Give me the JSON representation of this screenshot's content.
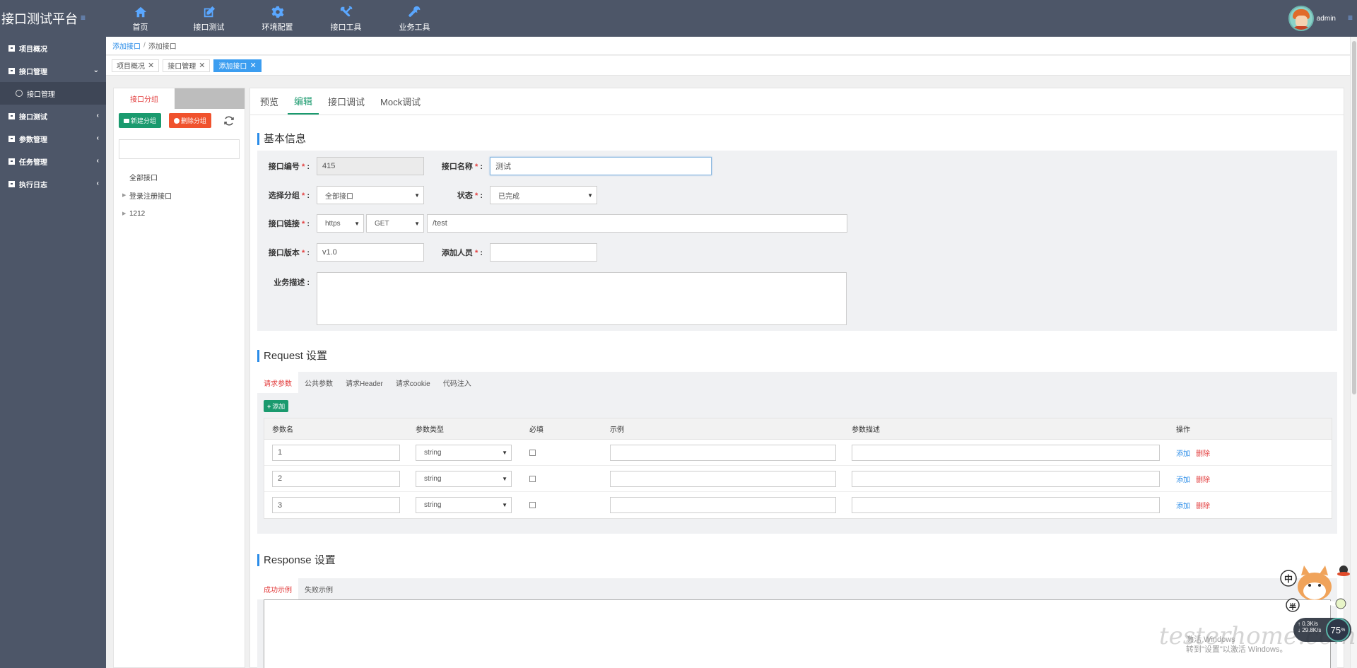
{
  "app": {
    "title": "接口测试平台",
    "menu_toggle": "≡"
  },
  "top_nav": [
    {
      "label": "首页",
      "icon": "home-icon"
    },
    {
      "label": "接口测试",
      "icon": "edit-icon"
    },
    {
      "label": "环境配置",
      "icon": "gear-icon"
    },
    {
      "label": "接口工具",
      "icon": "tools-icon"
    },
    {
      "label": "业务工具",
      "icon": "wrench-icon"
    }
  ],
  "user": {
    "name": "admin",
    "menu": "≡"
  },
  "sidebar": {
    "items": [
      {
        "label": "项目概况"
      },
      {
        "label": "接口管理",
        "chevron": "⌄"
      },
      {
        "label": "接口管理",
        "sub": true
      },
      {
        "label": "接口测试",
        "chevron": "‹"
      },
      {
        "label": "参数管理",
        "chevron": "‹"
      },
      {
        "label": "任务管理",
        "chevron": "‹"
      },
      {
        "label": "执行日志",
        "chevron": "‹"
      }
    ]
  },
  "breadcrumb": {
    "link": "添加接口",
    "sep": "/",
    "current": "添加接口"
  },
  "page_tabs": [
    {
      "label": "项目概况",
      "close": "✕"
    },
    {
      "label": "接口管理",
      "close": "✕"
    },
    {
      "label": "添加接口",
      "close": "✕",
      "active": true
    }
  ],
  "left_panel": {
    "tab": "接口分组",
    "new_group": "新建分组",
    "delete_group": "删除分组",
    "search_value": "",
    "tree": [
      {
        "label": "全部接口",
        "expandable": false
      },
      {
        "label": "登录注册接口",
        "expandable": true
      },
      {
        "label": "1212",
        "expandable": true
      }
    ]
  },
  "main_tabs": [
    {
      "label": "预览"
    },
    {
      "label": "编辑",
      "active": true
    },
    {
      "label": "接口调试"
    },
    {
      "label": "Mock调试"
    }
  ],
  "basic": {
    "title": "基本信息",
    "id_label": "接口编号",
    "id_value": "415",
    "name_label": "接口名称",
    "name_value": "测试",
    "group_label": "选择分组",
    "group_value": "全部接口",
    "status_label": "状态",
    "status_value": "已完成",
    "link_label": "接口链接",
    "protocol_value": "https",
    "method_value": "GET",
    "path_value": "/test",
    "version_label": "接口版本",
    "version_value": "v1.0",
    "creator_label": "添加人员",
    "creator_value": "",
    "desc_label": "业务描述",
    "desc_value": "",
    "required_mark": "*",
    "colon": ":"
  },
  "request": {
    "title": "Request 设置",
    "tabs": [
      "请求参数",
      "公共参数",
      "请求Header",
      "请求cookie",
      "代码注入"
    ],
    "add_label": "添加",
    "columns": [
      "参数名",
      "参数类型",
      "必填",
      "示例",
      "参数描述",
      "操作"
    ],
    "rows": [
      {
        "name": "1",
        "type": "string",
        "required": false,
        "example": "",
        "desc": "",
        "add": "添加",
        "del": "删除"
      },
      {
        "name": "2",
        "type": "string",
        "required": false,
        "example": "",
        "desc": "",
        "add": "添加",
        "del": "删除"
      },
      {
        "name": "3",
        "type": "string",
        "required": false,
        "example": "",
        "desc": "",
        "add": "添加",
        "del": "删除"
      }
    ]
  },
  "response": {
    "title": "Response 设置",
    "tabs": [
      "成功示例",
      "失败示例"
    ],
    "body": ""
  },
  "overlay": {
    "watermark": "testerhome.com",
    "activate_line1": "激活 Windows",
    "activate_line2": "转到\"设置\"以激活 Windows。",
    "up_speed": "0.3K/s",
    "down_speed": "29.8K/s",
    "cpu": "75",
    "cpu_unit": "%",
    "ime_label": "中",
    "half_label": "半"
  }
}
